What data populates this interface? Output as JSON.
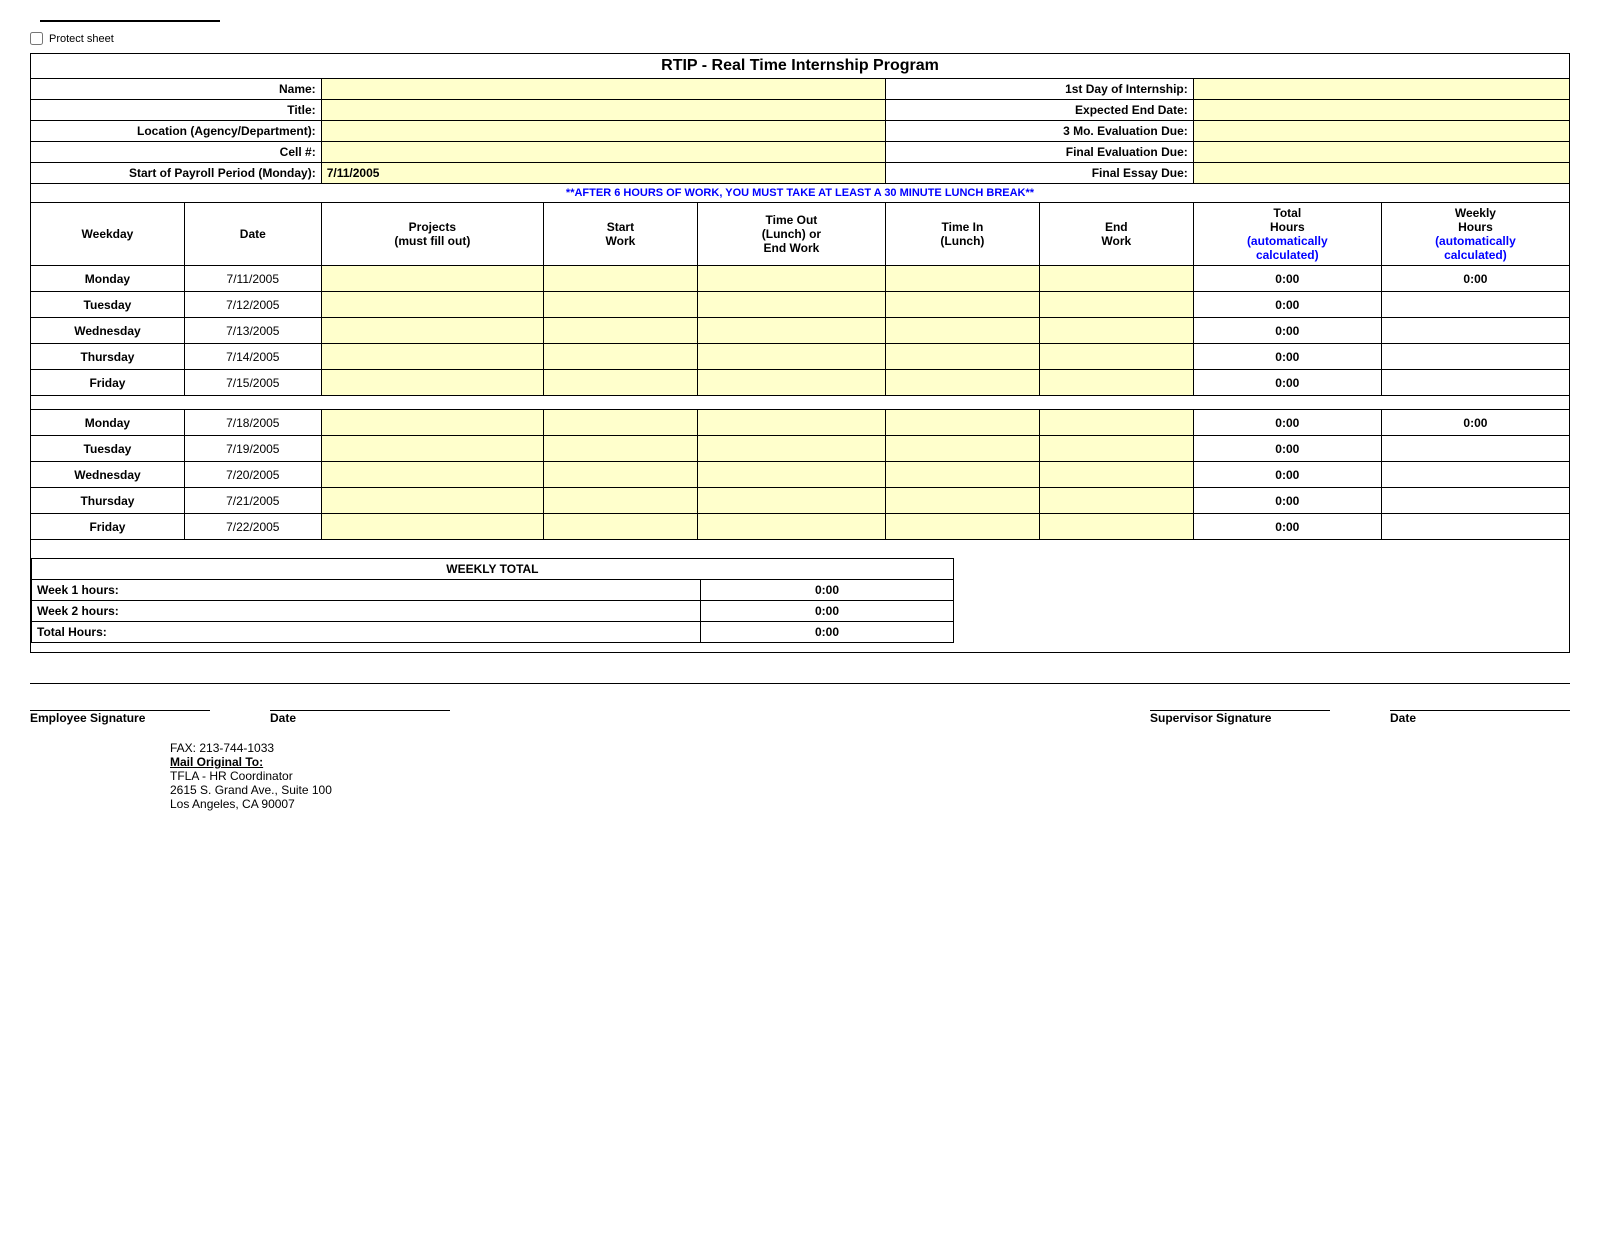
{
  "protect_sheet": {
    "checkbox_label": "Protect sheet"
  },
  "title": "RTIP - Real Time Internship Program",
  "header_fields": {
    "name_label": "Name:",
    "title_label": "Title:",
    "location_label": "Location (Agency/Department):",
    "cell_label": "Cell #:",
    "payroll_label": "Start of Payroll Period (Monday):",
    "payroll_value": "7/11/2005",
    "first_day_label": "1st Day of Internship:",
    "expected_end_label": "Expected End Date:",
    "eval_3mo_label": "3 Mo. Evaluation Due:",
    "final_eval_label": "Final Evaluation Due:",
    "final_essay_label": "Final Essay Due:"
  },
  "warning": "**AFTER 6 HOURS OF WORK, YOU MUST TAKE AT LEAST A 30 MINUTE LUNCH BREAK**",
  "columns": {
    "weekday": "Weekday",
    "date": "Date",
    "projects": "Projects\n(must fill out)",
    "start_work": "Start\nWork",
    "time_out": "Time Out\n(Lunch) or\nEnd Work",
    "time_in": "Time In\n(Lunch)",
    "end_work": "End\nWork",
    "total_hours": "Total\nHours\n(automatically\ncalculated)",
    "weekly_hours": "Weekly\nHours\n(automatically\ncalculated)"
  },
  "week1": [
    {
      "weekday": "Monday",
      "date": "7/11/2005",
      "total": "0:00",
      "weekly": "0:00"
    },
    {
      "weekday": "Tuesday",
      "date": "7/12/2005",
      "total": "0:00",
      "weekly": ""
    },
    {
      "weekday": "Wednesday",
      "date": "7/13/2005",
      "total": "0:00",
      "weekly": ""
    },
    {
      "weekday": "Thursday",
      "date": "7/14/2005",
      "total": "0:00",
      "weekly": ""
    },
    {
      "weekday": "Friday",
      "date": "7/15/2005",
      "total": "0:00",
      "weekly": ""
    }
  ],
  "week2": [
    {
      "weekday": "Monday",
      "date": "7/18/2005",
      "total": "0:00",
      "weekly": "0:00"
    },
    {
      "weekday": "Tuesday",
      "date": "7/19/2005",
      "total": "0:00",
      "weekly": ""
    },
    {
      "weekday": "Wednesday",
      "date": "7/20/2005",
      "total": "0:00",
      "weekly": ""
    },
    {
      "weekday": "Thursday",
      "date": "7/21/2005",
      "total": "0:00",
      "weekly": ""
    },
    {
      "weekday": "Friday",
      "date": "7/22/2005",
      "total": "0:00",
      "weekly": ""
    }
  ],
  "weekly_total": {
    "header": "WEEKLY TOTAL",
    "week1_label": "Week 1 hours:",
    "week1_value": "0:00",
    "week2_label": "Week 2 hours:",
    "week2_value": "0:00",
    "total_label": "Total Hours:",
    "total_value": "0:00"
  },
  "signature": {
    "employee_label": "Employee Signature",
    "date_label": "Date",
    "supervisor_label": "Supervisor Signature",
    "date2_label": "Date"
  },
  "footer": {
    "fax": "FAX:  213-744-1033",
    "mail_label": "Mail Original To:",
    "mail_line1": "TFLA - HR Coordinator",
    "mail_line2": "2615 S. Grand Ave., Suite 100",
    "mail_line3": "Los Angeles, CA  90007"
  }
}
